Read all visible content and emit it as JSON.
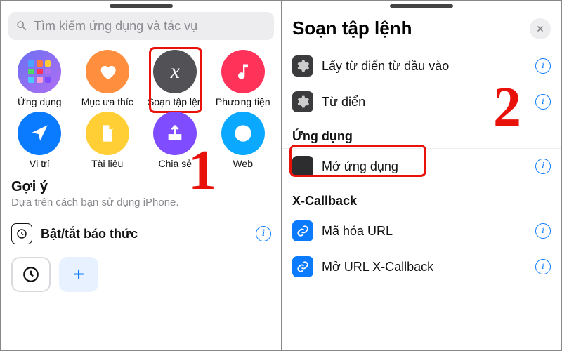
{
  "left": {
    "search_placeholder": "Tìm kiếm ứng dụng và tác vụ",
    "categories": [
      {
        "label": "Ứng dụng",
        "bg": "linear-gradient(135deg,#6b6ff2,#b06ff2)",
        "icon": "apps-grid-icon"
      },
      {
        "label": "Mục ưa thíc",
        "bg": "#ff8f3e",
        "icon": "heart-icon"
      },
      {
        "label": "Soạn tập lện",
        "bg": "#515156",
        "icon": "variable-x-icon",
        "highlighted": true
      },
      {
        "label": "Phương tiện",
        "bg": "#ff3259",
        "icon": "music-note-icon"
      },
      {
        "label": "Vị trí",
        "bg": "#0a7aff",
        "icon": "navigation-arrow-icon"
      },
      {
        "label": "Tài liệu",
        "bg": "#ffcf35",
        "icon": "document-icon"
      },
      {
        "label": "Chia sẻ",
        "bg": "#7f4cff",
        "icon": "share-icon"
      },
      {
        "label": "Web",
        "bg": "#0aa8ff",
        "icon": "compass-icon"
      }
    ],
    "suggestions_title": "Gợi ý",
    "suggestions_sub": "Dựa trên cách bạn sử dụng iPhone.",
    "suggestion_row": {
      "label": "Bật/tắt báo thức",
      "icon": "clock-app-icon"
    },
    "annotation_number": "1"
  },
  "right": {
    "title": "Soạn tập lệnh",
    "sections": {
      "top": [
        {
          "label": "Lấy từ điển từ đầu vào",
          "icon": "gear-icon"
        },
        {
          "label": "Từ điển",
          "icon": "gear-icon"
        }
      ],
      "app_header": "Ứng dụng",
      "app_row": {
        "label": "Mở ứng dụng",
        "icon": "open-app-icon",
        "highlighted": true
      },
      "xcallback_header": "X-Callback",
      "xcallback_rows": [
        {
          "label": "Mã hóa URL",
          "icon": "link-icon"
        },
        {
          "label": "Mở URL X-Callback",
          "icon": "link-icon"
        }
      ]
    },
    "annotation_number": "2"
  },
  "grid_colors": [
    "#4aa3ff",
    "#ff7a3d",
    "#ffcf35",
    "#4cd864",
    "#ff3259",
    "#b06ff2",
    "#4fc8ff",
    "#ff9fcf",
    "#7f4cff"
  ]
}
